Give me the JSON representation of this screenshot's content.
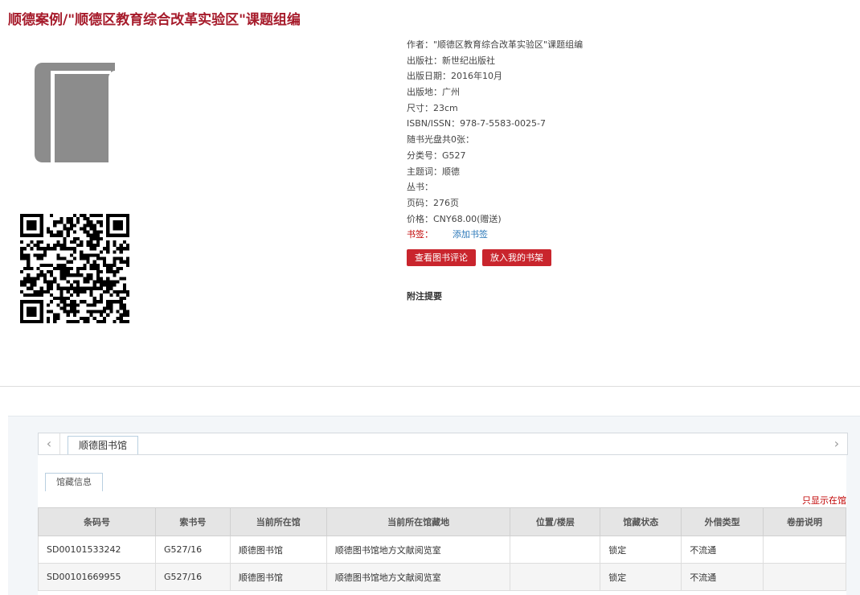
{
  "page": {
    "title": "顺德案例/\"顺德区教育综合改革实验区\"课题组编"
  },
  "book": {
    "author": "作者：\"顺德区教育综合改革实验区\"课题组编",
    "publisher": "出版社：新世纪出版社",
    "pub_date": "出版日期：2016年10月",
    "pub_place": "出版地：广州",
    "size": "尺寸：23cm",
    "isbn": "ISBN/ISSN：978-7-5583-0025-7",
    "disc": "随书光盘共0张：",
    "class_no": "分类号：G527",
    "subject": "主题词：顺德",
    "series": "丛书：",
    "pages": "页码：276页",
    "price": "价格：CNY68.00(赠送)",
    "bookmark_label": "书签：",
    "bookmark_link": "添加书签"
  },
  "actions": {
    "review": "查看图书评论",
    "shelf": "放入我的书架"
  },
  "annotation_heading": "附注提要",
  "icons": {
    "book": "book-icon",
    "qr": "qr-code-icon",
    "left": "chevron-left-icon",
    "right": "chevron-right-icon"
  },
  "colors": {
    "accent": "#a61b2b",
    "button": "#c9252d",
    "link": "#2a77b8"
  },
  "holdings": {
    "library_tab": "顺德图书馆",
    "subtab": "馆藏信息",
    "only_in_library": "只显示在馆",
    "columns": [
      "条码号",
      "索书号",
      "当前所在馆",
      "当前所在馆藏地",
      "位置/楼层",
      "馆藏状态",
      "外借类型",
      "卷册说明"
    ],
    "rows": [
      [
        "SD00101533242",
        "G527/16",
        "顺德图书馆",
        "顺德图书馆地方文献阅览室",
        "",
        "锁定",
        "不流通",
        ""
      ],
      [
        "SD00101669955",
        "G527/16",
        "顺德图书馆",
        "顺德图书馆地方文献阅览室",
        "",
        "锁定",
        "不流通",
        ""
      ]
    ]
  }
}
